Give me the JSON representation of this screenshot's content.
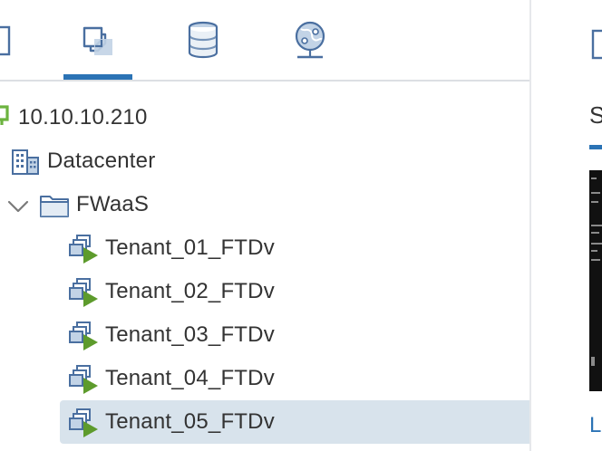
{
  "navigator": {
    "tabs": [
      {
        "id": "hosts-and-clusters",
        "icon": "hosts-clusters-icon",
        "active": false
      },
      {
        "id": "vms-and-templates",
        "icon": "vms-templates-icon",
        "active": true
      },
      {
        "id": "storage",
        "icon": "storage-icon",
        "active": false
      },
      {
        "id": "networking",
        "icon": "networking-icon",
        "active": false
      }
    ],
    "tree": [
      {
        "label": "10.10.10.210",
        "icon": "vcenter-icon",
        "level": 0
      },
      {
        "label": "Datacenter",
        "icon": "datacenter-icon",
        "level": 1
      },
      {
        "label": "FWaaS",
        "icon": "folder-icon",
        "level": 1,
        "expanded": true
      },
      {
        "label": "Tenant_01_FTDv",
        "icon": "vm-powered-on-icon",
        "level": 2
      },
      {
        "label": "Tenant_02_FTDv",
        "icon": "vm-powered-on-icon",
        "level": 2
      },
      {
        "label": "Tenant_03_FTDv",
        "icon": "vm-powered-on-icon",
        "level": 2
      },
      {
        "label": "Tenant_04_FTDv",
        "icon": "vm-powered-on-icon",
        "level": 2
      },
      {
        "label": "Tenant_05_FTDv",
        "icon": "vm-powered-on-icon",
        "level": 2,
        "selected": true
      }
    ]
  },
  "content": {
    "tab_label": "S",
    "link_label": "L"
  },
  "colors": {
    "accent": "#2b73b5",
    "selection": "#d8e3ec",
    "vm_running": "#5d9b2c",
    "vcenter": "#6cb33f"
  }
}
